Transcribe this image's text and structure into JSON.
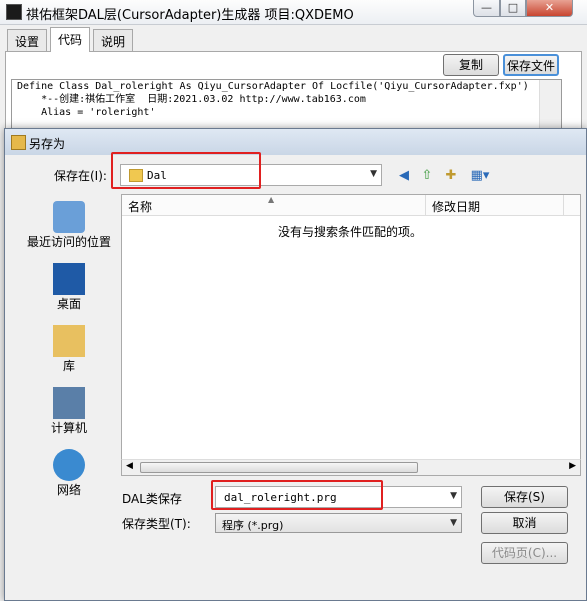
{
  "main_window": {
    "title": "祺佑框架DAL层(CursorAdapter)生成器 项目:QXDEMO",
    "controls": {
      "minimize": "—",
      "maximize": "□",
      "close": "✕"
    }
  },
  "tabs": [
    {
      "label": "设置",
      "active": false
    },
    {
      "label": "代码",
      "active": true
    },
    {
      "label": "说明",
      "active": false
    }
  ],
  "toolbar": {
    "copy_label": "复制",
    "save_file_label": "保存文件"
  },
  "code_lines": [
    "Define Class Dal_roleright As Qiyu_CursorAdapter Of Locfile('Qiyu_CursorAdapter.fxp')",
    "    *--创建:祺佑工作室  日期:2021.03.02 http://www.tab163.com",
    "    Alias = 'roleright'"
  ],
  "dialog": {
    "title": "另存为",
    "save_in_label": "保存在(I):",
    "location": "Dal",
    "places": [
      {
        "label": "最近访问的位置",
        "icon": "recent-places-icon"
      },
      {
        "label": "桌面",
        "icon": "desktop-icon"
      },
      {
        "label": "库",
        "icon": "library-icon"
      },
      {
        "label": "计算机",
        "icon": "computer-icon"
      },
      {
        "label": "网络",
        "icon": "network-icon"
      }
    ],
    "columns": {
      "name": "名称",
      "modified": "修改日期"
    },
    "empty_message": "没有与搜索条件匹配的项。",
    "filename_label": "DAL类保存",
    "filename_value": "dal_roleright.prg",
    "filetype_label": "保存类型(T):",
    "filetype_value": "程序 (*.prg)",
    "buttons": {
      "save": "保存(S)",
      "cancel": "取消",
      "codepage": "代码页(C)..."
    }
  },
  "colors": {
    "highlight": "#e02020",
    "folder": "#f0c850",
    "title_bar": "#c9d6e6"
  }
}
